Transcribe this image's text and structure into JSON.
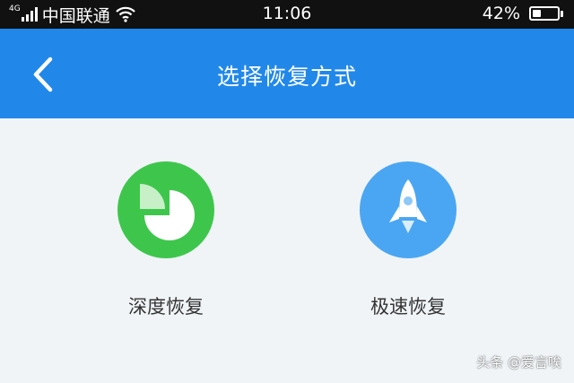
{
  "status_bar": {
    "network_type": "4G",
    "carrier": "中国联通",
    "time": "11:06",
    "battery": "42%",
    "battery_level": 0.42
  },
  "header": {
    "title": "选择恢复方式",
    "background_color": "#2188ea"
  },
  "options": [
    {
      "label": "深度恢复",
      "icon": "pie-chart-icon",
      "color": "#3ec64c"
    },
    {
      "label": "极速恢复",
      "icon": "rocket-icon",
      "color": "#4aa6f2"
    }
  ],
  "watermark": "头条 @爱言唉"
}
